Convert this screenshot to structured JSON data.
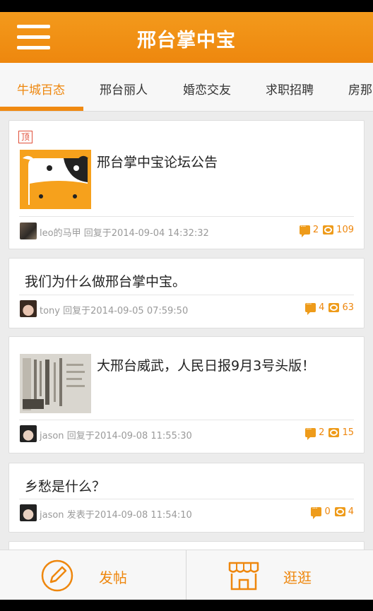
{
  "app": {
    "title": "邢台掌中宝"
  },
  "tabs": [
    "牛城百态",
    "邢台丽人",
    "婚恋交友",
    "求职招聘",
    "房那"
  ],
  "posts": [
    {
      "pinned": true,
      "pin_label": "顶",
      "title": "邢台掌中宝论坛公告",
      "author": "leo的马甲",
      "action": "回复于",
      "time": "2014-09-04 14:32:32",
      "comments": "2",
      "views": "109"
    },
    {
      "pinned": false,
      "title": "我们为什么做邢台掌中宝。",
      "author": "tony",
      "action": "回复于",
      "time": "2014-09-05 07:59:50",
      "comments": "4",
      "views": "63"
    },
    {
      "pinned": false,
      "title": "大邢台威武，人民日报9月3号头版！",
      "author": "jason",
      "action": "回复于",
      "time": "2014-09-08 11:55:30",
      "comments": "2",
      "views": "15"
    },
    {
      "pinned": false,
      "title": "乡愁是什么？",
      "author": "jason",
      "action": "发表于",
      "time": "2014-09-08 11:54:10",
      "comments": "0",
      "views": "4"
    }
  ],
  "bottom": {
    "post_label": "发帖",
    "browse_label": "逛逛"
  },
  "colors": {
    "accent": "#ee870e",
    "appbar": "#f39a1c"
  }
}
